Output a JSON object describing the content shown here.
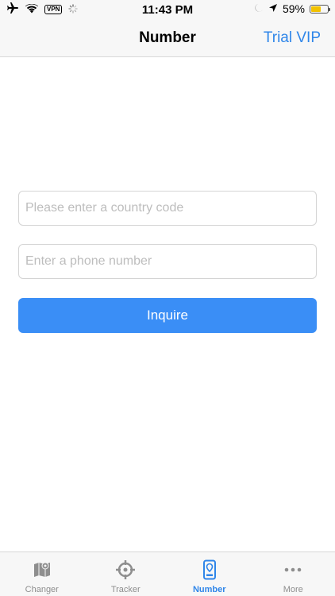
{
  "status_bar": {
    "vpn": "VPN",
    "time": "11:43 PM",
    "battery": "59%",
    "battery_level": 0.59
  },
  "nav": {
    "title": "Number",
    "action": "Trial VIP"
  },
  "form": {
    "country_code_placeholder": "Please enter a country code",
    "phone_placeholder": "Enter a phone number",
    "country_code_value": "",
    "phone_value": "",
    "submit_label": "Inquire"
  },
  "tabs": [
    {
      "label": "Changer",
      "icon": "map-icon",
      "active": false
    },
    {
      "label": "Tracker",
      "icon": "crosshair-icon",
      "active": false
    },
    {
      "label": "Number",
      "icon": "phone-location-icon",
      "active": true
    },
    {
      "label": "More",
      "icon": "more-icon",
      "active": false
    }
  ],
  "colors": {
    "accent": "#2f86e9",
    "button": "#3a8ef6",
    "inactive": "#8e8e8e"
  }
}
